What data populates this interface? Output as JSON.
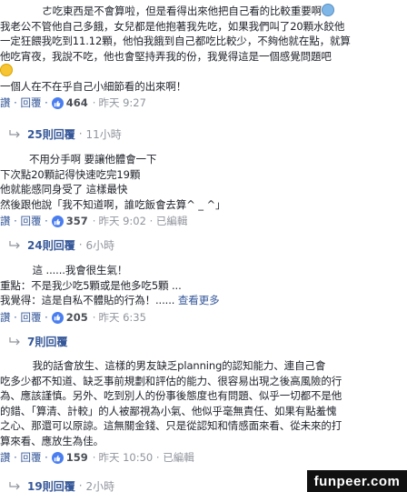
{
  "comments": [
    {
      "lines": [
        "             ㄜ吃東西是不會算啦，但是看得出來他把自己看的比較重要啊",
        "我老公不管他自己多餓，女兒都是他抱著我先吃，如果我們叫了20顆水餃他",
        "一定狂餵我吃到11.12顆，他怕我餓到自己都吃比較少，不夠他就在點，就算",
        "他吃宵夜，我說不吃，他也會堅持弄我的份，我覺得這是一個感覺問題吧",
        "一個人在不在乎自己小細節看的出來啊！"
      ],
      "emojis": [
        "worried-face-emoji",
        "grinning-face-emoji"
      ],
      "actions": {
        "reply": "讚 · 回覆 ·",
        "likes": "464",
        "time": "昨天 9:27"
      }
    },
    {
      "lines": [
        "         不用分手啊 要讓他體會一下",
        "下次點20顆記得快速吃完19顆",
        "他就能感同身受了 這樣最快",
        "然後跟他說「我不知道啊，誰吃飯會去算^ _ ^」"
      ],
      "actions": {
        "reply": "讚 · 回覆 ·",
        "likes": "357",
        "time": "昨天 9:02 · 已編輯"
      }
    },
    {
      "lines": [
        "          這 ......我會很生氣！",
        "重點：不是我少吃5顆或是他多吃5顆 ...",
        "我覺得：這是自私不體貼的行為！......"
      ],
      "see_more": "查看更多",
      "actions": {
        "reply": "讚 · 回覆 ·",
        "likes": "205",
        "time": "昨天 6:35"
      }
    },
    {
      "lines": [
        "          我的話會放生、這樣的男友缺乏planning的認知能力、連自己會",
        "吃多少都不知道、缺乏事前規劃和評估的能力、很容易出現之後高風險的行",
        "為、應該謹慎。另外、吃到別人的份事後態度也有問題、似乎一切都不是他",
        "的錯、「算清、計較」的人被鄙視為小氣、他似乎毫無責任、如果有點羞愧",
        "之心、那還可以原諒。這無關金錢、只是從認知和情感面來看、從未來的打",
        "算來看、應放生為佳。"
      ],
      "actions": {
        "reply": "讚 · 回覆 ·",
        "likes": "159",
        "time": "昨天 10:50 · 已編輯"
      }
    }
  ],
  "replies": [
    {
      "count": "25則回覆",
      "time": "11小時"
    },
    {
      "count": "24則回覆",
      "time": "6小時"
    },
    {
      "count": "7則回覆",
      "time": ""
    },
    {
      "count": "19則回覆",
      "time": "2小時"
    }
  ],
  "watermark": "funpeer.com",
  "colors": {
    "link": "#365899",
    "meta": "#90949c",
    "text": "#1d2129",
    "like_badge": "#4a7ef0"
  }
}
